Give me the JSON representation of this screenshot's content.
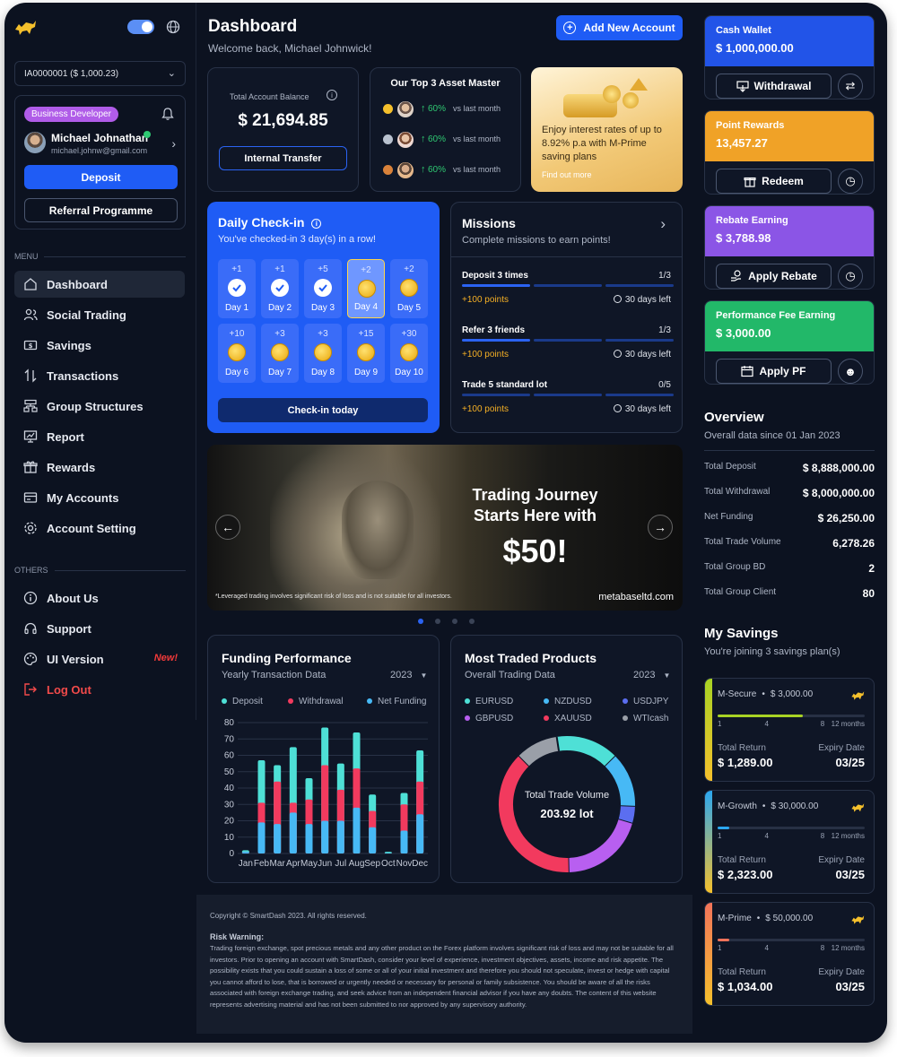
{
  "account_select": "IA0000001 ($ 1,000.23)",
  "profile": {
    "role_badge": "Business Developer",
    "name": "Michael Johnathan",
    "email": "michael.johnw@gmail.com",
    "deposit": "Deposit",
    "referral": "Referral Programme"
  },
  "menu": {
    "title": "MENU",
    "items": [
      {
        "label": "Dashboard",
        "icon": "home-icon"
      },
      {
        "label": "Social Trading",
        "icon": "users-icon"
      },
      {
        "label": "Savings",
        "icon": "savings-icon"
      },
      {
        "label": "Transactions",
        "icon": "transactions-icon"
      },
      {
        "label": "Group Structures",
        "icon": "group-structure-icon"
      },
      {
        "label": "Report",
        "icon": "report-icon"
      },
      {
        "label": "Rewards",
        "icon": "gift-icon"
      },
      {
        "label": "My Accounts",
        "icon": "accounts-icon"
      },
      {
        "label": "Account Setting",
        "icon": "gear-icon"
      }
    ]
  },
  "others": {
    "title": "OTHERS",
    "items": [
      {
        "label": "About Us",
        "icon": "info-icon"
      },
      {
        "label": "Support",
        "icon": "headset-icon"
      },
      {
        "label": "UI Version",
        "icon": "palette-icon",
        "badge": "New!"
      },
      {
        "label": "Log Out",
        "icon": "logout-icon"
      }
    ]
  },
  "header": {
    "title": "Dashboard",
    "welcome": "Welcome back, Michael Johnwick!",
    "add_account": "Add New Account"
  },
  "balance": {
    "label": "Total Account Balance",
    "value": "$ 21,694.85",
    "transfer": "Internal Transfer"
  },
  "top3": {
    "title": "Our Top 3 Asset Master",
    "rows": [
      {
        "pct": "60%",
        "text": "vs last month",
        "medal": "#f5c02c"
      },
      {
        "pct": "60%",
        "text": "vs last month",
        "medal": "#b9c2cf"
      },
      {
        "pct": "60%",
        "text": "vs last month",
        "medal": "#d9823a"
      }
    ]
  },
  "promo": {
    "text": "Enjoy interest rates of up to 8.92% p.a with M-Prime saving plans",
    "link": "Find out more"
  },
  "checkin": {
    "title": "Daily Check-in",
    "subtitle": "You've checked-in 3 day(s) in a row!",
    "button": "Check-in today",
    "days": [
      {
        "pts": "+1",
        "label": "Day 1",
        "state": "done"
      },
      {
        "pts": "+1",
        "label": "Day 2",
        "state": "done"
      },
      {
        "pts": "+5",
        "label": "Day 3",
        "state": "done"
      },
      {
        "pts": "+2",
        "label": "Day 4",
        "state": "today"
      },
      {
        "pts": "+2",
        "label": "Day 5",
        "state": "todo"
      },
      {
        "pts": "+10",
        "label": "Day 6",
        "state": "todo"
      },
      {
        "pts": "+3",
        "label": "Day 7",
        "state": "todo"
      },
      {
        "pts": "+3",
        "label": "Day 8",
        "state": "todo"
      },
      {
        "pts": "+15",
        "label": "Day 9",
        "state": "todo"
      },
      {
        "pts": "+30",
        "label": "Day 10",
        "state": "todo"
      }
    ]
  },
  "missions": {
    "title": "Missions",
    "subtitle": "Complete missions to earn points!",
    "items": [
      {
        "name": "Deposit 3 times",
        "progress": "1/3",
        "done": 1,
        "total": 3,
        "reward": "+100 points",
        "left": "30 days left"
      },
      {
        "name": "Refer 3 friends",
        "progress": "1/3",
        "done": 1,
        "total": 3,
        "reward": "+100 points",
        "left": "30 days left"
      },
      {
        "name": "Trade 5 standard lot",
        "progress": "0/5",
        "done": 0,
        "total": 3,
        "reward": "+100 points",
        "left": "30 days left"
      }
    ]
  },
  "banner": {
    "line1": "Trading Journey",
    "line2": "Starts Here with",
    "amount": "$50!",
    "disclaimer": "*Leveraged trading involves significant risk of loss and is not suitable for all investors.",
    "site": "metabaseltd.com"
  },
  "funding": {
    "title": "Funding Performance",
    "subtitle": "Yearly Transaction Data",
    "year": "2023"
  },
  "products": {
    "title": "Most Traded Products",
    "subtitle": "Overall Trading Data",
    "year": "2023",
    "center_label": "Total Trade Volume",
    "center_value": "203.92 lot",
    "legend": [
      {
        "name": "EURUSD",
        "color": "#4ee0d6"
      },
      {
        "name": "NZDUSD",
        "color": "#47b9f5"
      },
      {
        "name": "USDJPY",
        "color": "#5b6ef0"
      },
      {
        "name": "GBPUSD",
        "color": "#b85ff0"
      },
      {
        "name": "XAUUSD",
        "color": "#f23a5e"
      },
      {
        "name": "WTIcash",
        "color": "#9a9fa8"
      }
    ]
  },
  "chart_data": [
    {
      "type": "bar",
      "title": "Funding Performance",
      "ylim": [
        0,
        80
      ],
      "categories": [
        "Jan",
        "Feb",
        "Mar",
        "Apr",
        "May",
        "Jun",
        "Jul",
        "Aug",
        "Sep",
        "Oct",
        "Nov",
        "Dec"
      ],
      "series": [
        {
          "name": "Deposit",
          "color": "#4ee0d6",
          "values": [
            2,
            57,
            54,
            65,
            46,
            77,
            55,
            74,
            36,
            1,
            37,
            63
          ]
        },
        {
          "name": "Withdrawal",
          "color": "#f23a5e",
          "values": [
            1,
            31,
            44,
            31,
            33,
            54,
            39,
            52,
            26,
            0,
            30,
            44
          ]
        },
        {
          "name": "Net Funding",
          "color": "#47b9f5",
          "values": [
            1,
            19,
            18,
            25,
            18,
            20,
            20,
            28,
            16,
            0,
            14,
            24
          ]
        }
      ]
    },
    {
      "type": "pie",
      "title": "Most Traded Products",
      "categories": [
        "EURUSD",
        "NZDUSD",
        "USDJPY",
        "GBPUSD",
        "XAUUSD",
        "WTIcash"
      ],
      "values": [
        15,
        13,
        4,
        20,
        38,
        10
      ]
    }
  ],
  "wallets": [
    {
      "title": "Cash Wallet",
      "value": "$ 1,000,000.00",
      "button": "Withdrawal",
      "icon": "withdrawal-icon",
      "side_icon": "swap-icon",
      "color": "#2254e8"
    },
    {
      "title": "Point Rewards",
      "value": "13,457.27",
      "button": "Redeem",
      "icon": "gift-icon",
      "side_icon": "history-icon",
      "color": "#f0a227"
    },
    {
      "title": "Rebate Earning",
      "value": "$ 3,788.98",
      "button": "Apply Rebate",
      "icon": "rebate-icon",
      "side_icon": "history-icon",
      "color": "#8b55e6"
    },
    {
      "title": "Performance Fee Earning",
      "value": "$ 3,000.00",
      "button": "Apply PF",
      "icon": "pf-icon",
      "side_icon": "add-user-icon",
      "color": "#22b869"
    }
  ],
  "overview": {
    "title": "Overview",
    "subtitle": "Overall data since 01 Jan 2023",
    "rows": [
      {
        "label": "Total Deposit",
        "value": "$ 8,888,000.00"
      },
      {
        "label": "Total Withdrawal",
        "value": "$ 8,000,000.00"
      },
      {
        "label": "Net Funding",
        "value": "$ 26,250.00"
      },
      {
        "label": "Total Trade Volume",
        "value": "6,278.26"
      },
      {
        "label": "Total Group BD",
        "value": "2"
      },
      {
        "label": "Total Group Client",
        "value": "80"
      }
    ]
  },
  "savings": {
    "title": "My Savings",
    "subtitle": "You're joining 3 savings plan(s)",
    "plans": [
      {
        "name": "M-Secure",
        "amount": "$ 3,000.00",
        "progress": 0.58,
        "color": "#a8d324",
        "return_label": "Total Return",
        "return": "$ 1,289.00",
        "expiry_label": "Expiry Date",
        "expiry": "03/25"
      },
      {
        "name": "M-Growth",
        "amount": "$ 30,000.00",
        "progress": 0.08,
        "color": "#2ba7f0",
        "return_label": "Total Return",
        "return": "$ 2,323.00",
        "expiry_label": "Expiry Date",
        "expiry": "03/25"
      },
      {
        "name": "M-Prime",
        "amount": "$ 50,000.00",
        "progress": 0.08,
        "color": "#f2735a",
        "return_label": "Total Return",
        "return": "$ 1,034.00",
        "expiry_label": "Expiry Date",
        "expiry": "03/25"
      }
    ],
    "ticks": [
      "1",
      "4",
      "8",
      "12 months"
    ]
  },
  "footer": {
    "copyright": "Copyright © SmartDash 2023. All rights reserved.",
    "risk_title": "Risk Warning:",
    "risk_text": "Trading foreign exchange, spot precious metals and any other product on the Forex platform involves significant risk of loss and may not be suitable for all investors. Prior to opening an account with SmartDash, consider your level of experience, investment objectives, assets, income and risk appetite. The possibility exists that you could sustain a loss of some or all of your initial investment and therefore you should not speculate, invest or hedge with capital you cannot afford to lose, that is borrowed or urgently needed or necessary for personal or family subsistence. You should be aware of all the risks associated with foreign exchange trading, and seek advice from an independent financial advisor if you have any doubts. The content of this website represents advertising material and has not been submitted to nor approved by any supervisory authority."
  }
}
